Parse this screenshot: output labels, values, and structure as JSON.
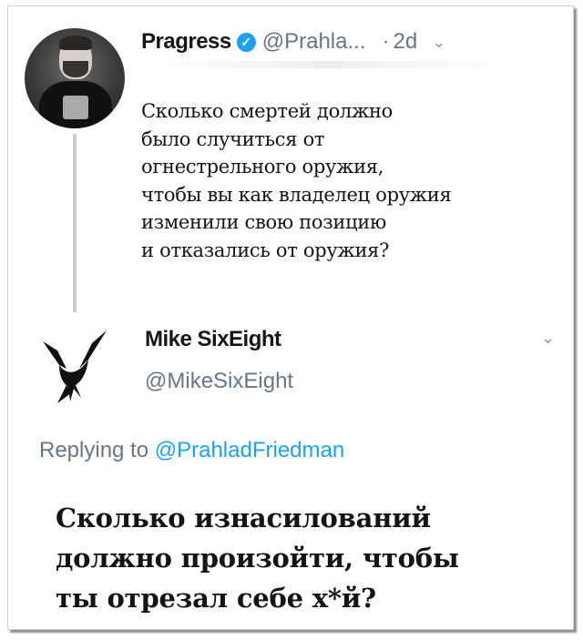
{
  "original_tweet": {
    "author_name": "Pragress",
    "verified_icon": "verified-check-icon",
    "handle": "@Prahla...",
    "separator": "·",
    "time": "2d",
    "menu_icon": "chevron-down-icon",
    "text": "Сколько смертей должно\nбыло случиться от\nогнестрельного оружия,\nчтобы вы как владелец оружия\nизменили свою позицию\nи отказались от оружия?"
  },
  "reply_tweet": {
    "author_name": "Mike SixEight",
    "handle": "@MikeSixEight",
    "menu_icon": "chevron-down-icon",
    "replying_prefix": "Replying to",
    "replying_to": "@PrahladFriedman",
    "text": "Сколько изнасилований\nдолжно произойти, чтобы\nты отрезал себе х*й?"
  },
  "colors": {
    "text": "#14171a",
    "secondary": "#657786",
    "accent": "#1da1f2",
    "thread_line": "#c8cdd2"
  }
}
